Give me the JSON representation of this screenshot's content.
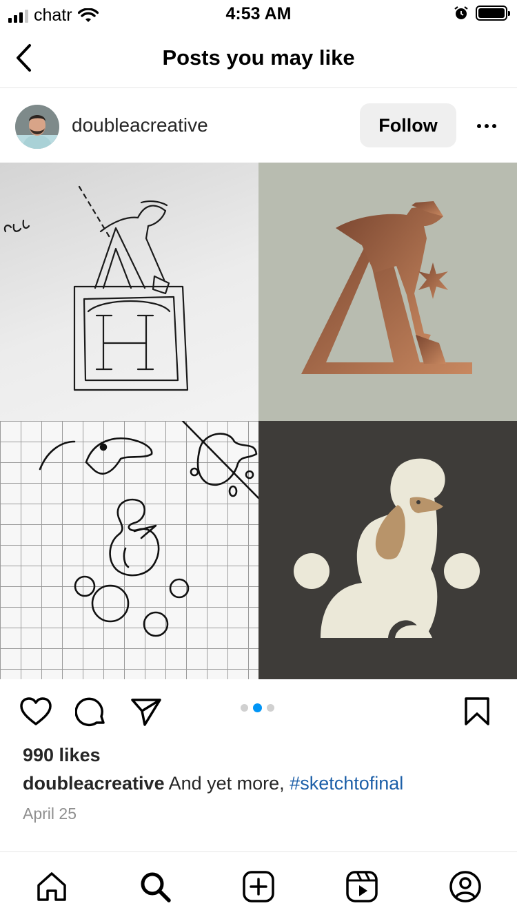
{
  "status_bar": {
    "carrier": "chatr",
    "time": "4:53 AM",
    "icons": [
      "signal-icon",
      "wifi-icon",
      "alarm-icon",
      "battery-icon"
    ]
  },
  "header": {
    "title": "Posts you may like",
    "back_icon": "chevron-left-icon"
  },
  "post": {
    "username": "doubleacreative",
    "follow_label": "Follow",
    "more_icon": "more-horizontal-icon",
    "image": {
      "tiles": [
        "sketch-hole-digger",
        "final-hole-digger-logo",
        "sketch-poodle-grid",
        "final-poodle-logo"
      ],
      "colors": {
        "copper": "#a86a45",
        "sage": "#b8bcb0",
        "charcoal": "#3e3c39",
        "cream": "#ebe8d8",
        "tan": "#b8946a"
      }
    },
    "carousel": {
      "count": 3,
      "active_index": 1
    },
    "likes": "990 likes",
    "caption": {
      "user": "doubleacreative",
      "text": " And yet more, ",
      "hashtag": "#sketchtofinal"
    },
    "date": "April 25"
  },
  "actions": {
    "like_icon": "heart-icon",
    "comment_icon": "comment-icon",
    "share_icon": "paper-plane-icon",
    "save_icon": "bookmark-icon"
  },
  "tab_bar": {
    "items": [
      "home-icon",
      "search-icon",
      "create-icon",
      "reels-icon",
      "profile-icon"
    ],
    "active": "search-icon"
  },
  "colors": {
    "link": "#1c5fa8",
    "accent": "#0095f6",
    "muted": "#8e8e8e",
    "button_bg": "#efefef"
  }
}
